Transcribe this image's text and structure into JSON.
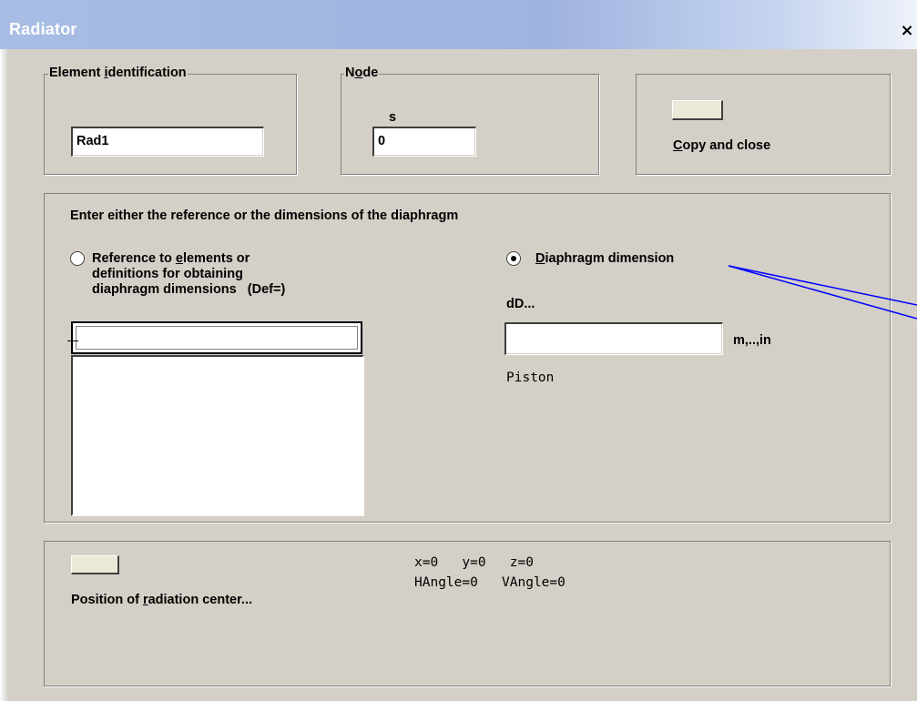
{
  "window": {
    "title": "Radiator",
    "close_glyph": "×"
  },
  "element_identification": {
    "legend_before": "Element ",
    "legend_mnemonic": "i",
    "legend_after": "dentification",
    "value": "Rad1"
  },
  "node": {
    "legend_before": "N",
    "legend_mnemonic": "o",
    "legend_after": "de",
    "sublabel": "s",
    "value": "0"
  },
  "copy_close": {
    "label_mnemonic": "C",
    "label_after": "opy and close"
  },
  "diaphragm": {
    "instruction": "Enter either the reference or the dimensions of the diaphragm",
    "reference_radio": {
      "selected": false,
      "line1_before": "Reference to ",
      "line1_mnemonic": "e",
      "line1_after": "lements or",
      "line2": "definitions for obtaining",
      "line3": "diaphragm dimensions   (Def=)"
    },
    "reference_input_value": "",
    "reference_list_items": [],
    "dimension_radio": {
      "selected": true,
      "label_mnemonic": "D",
      "label_after": "iaphragm dimension"
    },
    "dimension_field_label": "dD...",
    "dimension_value": "",
    "dimension_unit": "m,..,in",
    "type_text": "Piston"
  },
  "radiation_center": {
    "label_before": "Position of ",
    "label_mnemonic": "r",
    "label_after": "adiation center...",
    "coords_line1": "x=0   y=0   z=0",
    "coords_line2": "HAngle=0   VAngle=0"
  },
  "colors": {
    "dialog_bg": "#d4d0c8",
    "title_gradient_start": "#a8bde4",
    "callout_line": "#0000ff"
  }
}
